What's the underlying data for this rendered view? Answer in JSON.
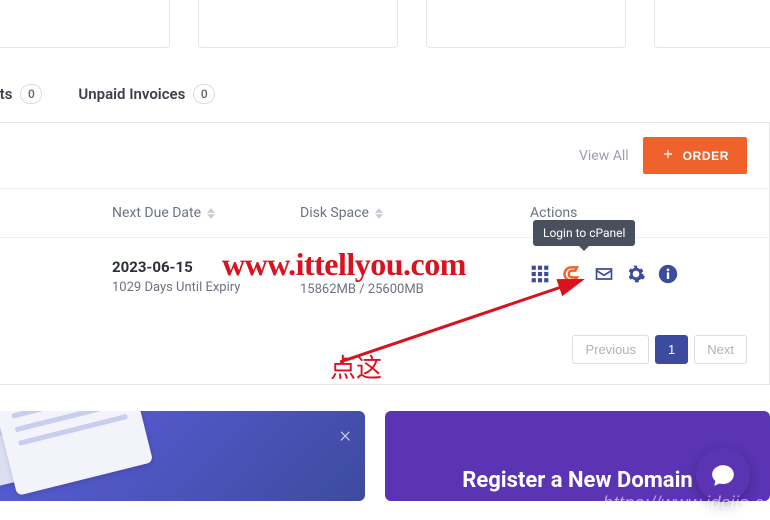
{
  "summary": {
    "tickets_label": "ckets",
    "tickets_count": "0",
    "invoices_label": "Unpaid Invoices",
    "invoices_count": "0"
  },
  "panel": {
    "view_all": "View All",
    "order_label": "ORDER"
  },
  "columns": {
    "due": "Next Due Date",
    "disk": "Disk Space",
    "actions": "Actions"
  },
  "row": {
    "due_date": "2023-06-15",
    "expiry_note": "1029 Days Until Expiry",
    "disk_usage": "15862MB / 25600MB"
  },
  "action_tooltip": "Login to cPanel",
  "action_icons": {
    "grid": "apps-grid-icon",
    "cpanel": "cpanel-icon",
    "mail": "mail-icon",
    "gear": "gear-icon",
    "info": "info-icon"
  },
  "pagination": {
    "prev": "Previous",
    "page": "1",
    "next": "Next"
  },
  "promo_b_title": "Register a New Domain",
  "overlays": {
    "watermark": "www.ittellyou.com",
    "annotation": "点这",
    "bottom_url": "https://www.idciis.c"
  },
  "colors": {
    "brand_orange": "#f0622c",
    "brand_blue": "#3d4b9e",
    "cpanel_orange": "#f0622c",
    "icon_blue": "#3d4b9e",
    "red": "#d8121e"
  }
}
